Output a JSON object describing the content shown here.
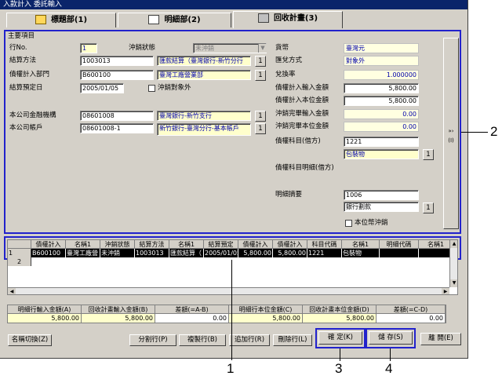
{
  "title": "入款計入 委託輸入",
  "tabs": [
    {
      "label": "標題部(1)"
    },
    {
      "label": "明細部(2)"
    },
    {
      "label": "回收計畫(3)"
    }
  ],
  "section_title": "主要項目",
  "left": {
    "row_no_label": "行No.",
    "row_no_value": "1",
    "status_label": "沖銷狀態",
    "status_value": "未沖銷",
    "method_label": "結算方法",
    "method_code": "1003013",
    "method_name": "匯款結算（臺灣銀行-新竹分行",
    "dept_label": "債權計入部門",
    "dept_code": "B600100",
    "dept_name": "臺灣工廠營業部",
    "date_label": "結算預定日",
    "date_value": "2005/01/05",
    "offset_target_label": "沖銷對象外",
    "bank_label": "本公司金融機構",
    "bank_code": "08601008",
    "bank_name": "臺灣銀行-新竹支行",
    "account_label": "本公司帳戶",
    "account_code": "08601008-1",
    "account_name": "新竹銀行-臺灣分行-基本帳戶"
  },
  "right": {
    "currency_label": "貨幣",
    "currency_value": "臺灣元",
    "rate_type_label": "匯兌方式",
    "rate_type_value": "對象外",
    "rate_label": "兌換率",
    "rate_value": "1.000000",
    "input_amount_label": "債權計入輸入金額",
    "input_amount_value": "5,800.00",
    "local_amount_label": "債權計入本位金額",
    "local_amount_value": "5,800.00",
    "offset_input_label": "沖銷完畢輸入金額",
    "offset_input_value": "0.00",
    "offset_local_label": "沖銷完畢本位金額",
    "offset_local_value": "0.00",
    "subject_label": "債權科目(借方)",
    "subject_code": "1221",
    "subject_name": "包裝物",
    "subject_detail_label": "債權科目明細(借方)",
    "summary_label": "明細摘要",
    "summary_code": "1006",
    "summary_name": "銀行劃款",
    "local_offset_label": "本位幣沖銷"
  },
  "side_button": "(I)",
  "lookup_glyph": "1",
  "grid": {
    "headers": [
      "債權計入",
      "名稱1",
      "沖銷狀態",
      "結算方法",
      "名稱1",
      "結算預定",
      "債權計入",
      "債權計入",
      "科目代碼",
      "名稱1",
      "明細代碼",
      "名稱1"
    ],
    "rows": [
      {
        "num": "1",
        "cells": [
          "B600100",
          "臺灣工廠營",
          "未沖銷",
          "1003013",
          "匯款結算（",
          "2005/01/05",
          "5,800.00",
          "5,800.00",
          "1221",
          "包裝物",
          "",
          ""
        ]
      },
      {
        "num": "2",
        "cells": []
      }
    ]
  },
  "totals": {
    "headers": [
      "明細行輸入金額(A)",
      "回收計畫輸入金額(B)",
      "差額(=A-B)",
      "明細行本位金額(C)",
      "回收計畫本位金額(D)",
      "差額(=C-D)"
    ],
    "values": [
      "5,800.00",
      "5,800.00",
      "0.00",
      "5,800.00",
      "5,800.00",
      "0.00"
    ]
  },
  "buttons": {
    "name_switch": "名稱切換(Z)",
    "split_row": "分割行(P)",
    "copy_row": "複製行(B)",
    "add_row": "追加行(R)",
    "delete_row": "刪除行(L)",
    "confirm": "確 定(K)",
    "save": "儲 存(S)",
    "close": "離 開(E)"
  },
  "callouts": {
    "c1": "1",
    "c2": "2",
    "c3": "3",
    "c4": "4"
  },
  "colors": {
    "accent_outline": "#2222cc",
    "title_bar": "#0a246a",
    "highlight_field": "#ffffcc"
  }
}
